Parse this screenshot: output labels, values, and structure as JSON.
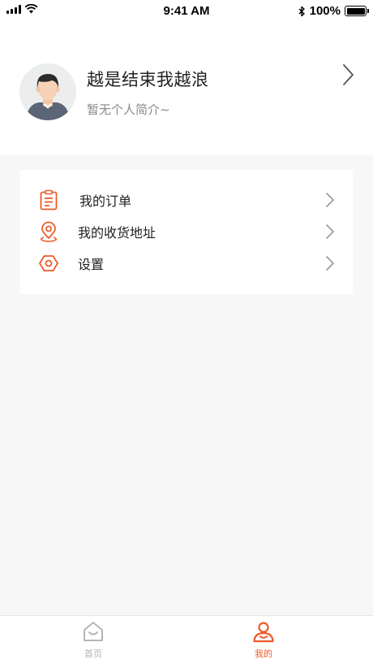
{
  "status_bar": {
    "time": "9:41 AM",
    "battery": "100%"
  },
  "profile": {
    "name": "越是结束我越浪",
    "bio": "暂无个人简介~"
  },
  "menu": {
    "items": [
      {
        "label": "我的订单",
        "icon": "clipboard-icon"
      },
      {
        "label": "我的收货地址",
        "icon": "location-pin-icon"
      },
      {
        "label": "设置",
        "icon": "hexagon-settings-icon"
      }
    ]
  },
  "tab_bar": {
    "tabs": [
      {
        "label": "首页",
        "icon": "home-icon",
        "active": false
      },
      {
        "label": "我的",
        "icon": "user-icon",
        "active": true
      }
    ]
  },
  "colors": {
    "accent": "#f05a28",
    "inactive": "#b5b5b5",
    "background": "#f7f7f7"
  }
}
